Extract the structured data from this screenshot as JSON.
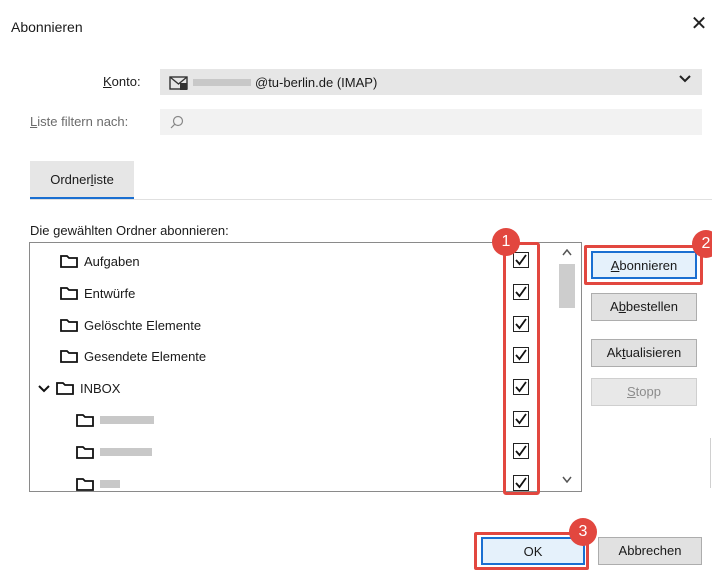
{
  "window": {
    "title": "Abonnieren"
  },
  "account": {
    "label": "Konto:",
    "value": "@tu-berlin.de (IMAP)"
  },
  "filter": {
    "label": "Liste filtern nach:",
    "value": ""
  },
  "tabs": [
    {
      "label": "Ordnerliste"
    }
  ],
  "list": {
    "header": "Die gewählten Ordner abonnieren:",
    "items": [
      {
        "label": "Aufgaben",
        "checked": true
      },
      {
        "label": "Entwürfe",
        "checked": true
      },
      {
        "label": "Gelöschte Elemente",
        "checked": true
      },
      {
        "label": "Gesendete Elemente",
        "checked": true
      },
      {
        "label": "INBOX",
        "checked": true,
        "expanded": true
      },
      {
        "label": "",
        "checked": true,
        "indent": true
      },
      {
        "label": "",
        "checked": true,
        "indent": true
      },
      {
        "label": "",
        "checked": true,
        "indent": true
      }
    ]
  },
  "buttons": {
    "subscribe": "Abonnieren",
    "unsubscribe": "Abbestellen",
    "refresh": "Aktualisieren",
    "stop": "Stopp",
    "ok": "OK",
    "cancel": "Abbrechen"
  },
  "badges": [
    "1",
    "2",
    "3"
  ],
  "colors": {
    "accent": "#1a6fd1",
    "highlight": "#e2473f"
  },
  "icons": {
    "close": "×",
    "dropdown": "chevron-down",
    "search": "magnifier",
    "folder": "folder",
    "expand": "chevron-down"
  }
}
